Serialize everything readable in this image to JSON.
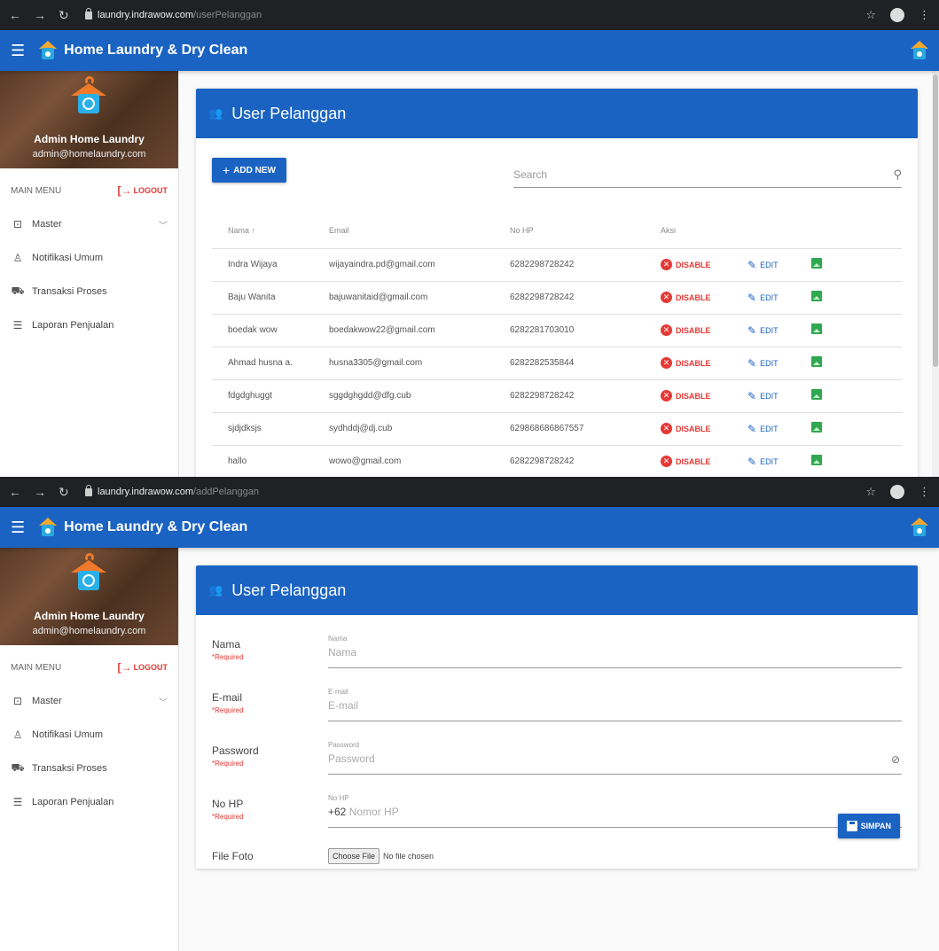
{
  "app": {
    "title": "Home Laundry & Dry Clean",
    "accent": "#1a63c2"
  },
  "user": {
    "name": "Admin Home Laundry",
    "email": "admin@homelaundry.com"
  },
  "sidebar": {
    "section_label": "MAIN MENU",
    "logout_label": "LOGOUT",
    "items": [
      {
        "label": "Master",
        "icon": "master-icon"
      },
      {
        "label": "Notifikasi Umum",
        "icon": "bell-icon"
      },
      {
        "label": "Transaksi Proses",
        "icon": "cart-icon"
      },
      {
        "label": "Laporan Penjualan",
        "icon": "report-icon"
      }
    ]
  },
  "list_page": {
    "browser": {
      "host": "laundry.indrawow.com",
      "path": "/userPelanggan"
    },
    "card_title": "User Pelanggan",
    "add_button": "ADD NEW",
    "search_placeholder": "Search",
    "columns": [
      "Nama",
      "Email",
      "No HP",
      "Aksi"
    ],
    "sort_indicator": "↑",
    "actions": {
      "disable": "DISABLE",
      "edit": "EDIT"
    },
    "rows": [
      {
        "nama": "Indra Wijaya",
        "email": "wijayaindra.pd@gmail.com",
        "hp": "6282298728242"
      },
      {
        "nama": "Baju Wanita",
        "email": "bajuwanitaid@gmail.com",
        "hp": "6282298728242"
      },
      {
        "nama": "boedak wow",
        "email": "boedakwow22@gmail.com",
        "hp": "6282281703010"
      },
      {
        "nama": "Ahmad husna a.",
        "email": "husna3305@gmail.com",
        "hp": "6282282535844"
      },
      {
        "nama": "fdgdghuggt",
        "email": "sggdghgdd@dfg.cub",
        "hp": "6282298728242"
      },
      {
        "nama": "sjdjdksjs",
        "email": "sydhddj@dj.cub",
        "hp": "629868686867557"
      },
      {
        "nama": "hallo",
        "email": "wowo@gmail.com",
        "hp": "6282298728242"
      }
    ]
  },
  "add_page": {
    "browser": {
      "host": "laundry.indrawow.com",
      "path": "/addPelanggan"
    },
    "card_title": "User Pelanggan",
    "required_text": "*Required",
    "fields": {
      "nama": {
        "label": "Nama",
        "small": "Nama",
        "placeholder": "Nama"
      },
      "email": {
        "label": "E-mail",
        "small": "E-mail",
        "placeholder": "E-mail"
      },
      "password": {
        "label": "Password",
        "small": "Password",
        "placeholder": "Password"
      },
      "nohp": {
        "label": "No HP",
        "small": "No HP",
        "prefix": "+62",
        "placeholder": "Nomor HP"
      }
    },
    "file": {
      "label": "File Foto",
      "button": "Choose File",
      "status": "No file chosen"
    },
    "save_button": "SIMPAN"
  }
}
